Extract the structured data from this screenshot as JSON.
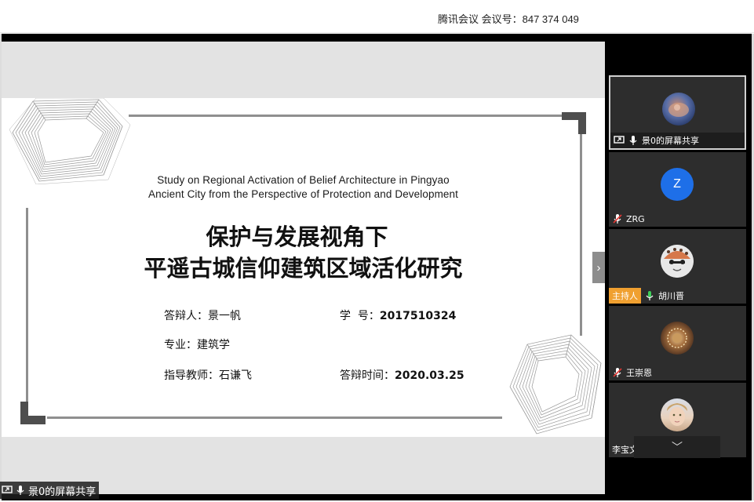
{
  "window": {
    "title": "腾讯会议 会议号：847 374 049"
  },
  "slide": {
    "title_en_line1": "Study on Regional Activation of Belief Architecture in Pingyao",
    "title_en_line2": "Ancient City from the Perspective of Protection and Development",
    "title_zh_line1": "保护与发展视角下",
    "title_zh_line2": "平遥古城信仰建筑区域活化研究",
    "defender_label": "答辩人：",
    "defender_value": "景一帆",
    "student_id_label": "学  号：",
    "student_id_value": "2017510324",
    "major_label": "专业：",
    "major_value": "建筑学",
    "advisor_label": "指导教师：",
    "advisor_value": "石谦飞",
    "date_label": "答辩时间：",
    "date_value": "2020.03.25"
  },
  "share": {
    "label": "景0的屏幕共享",
    "next_icon": "chevron-right-icon"
  },
  "participants": [
    {
      "name": "景0的屏幕共享",
      "avatar": "planet-photo-avatar",
      "mic": "mic-on",
      "screen_icon": "screen-share-icon"
    },
    {
      "name": "ZRG",
      "avatar_letter": "Z",
      "avatar_color": "#1e6fe8",
      "mic": "mic-muted"
    },
    {
      "name": "胡川晋",
      "avatar": "cartoon-cat-avatar",
      "mic": "mic-on",
      "badge": "主持人"
    },
    {
      "name": "王崇恩",
      "avatar": "ornament-photo-avatar",
      "mic": "mic-muted"
    },
    {
      "name": "李宝文",
      "avatar": "portrait-photo-avatar",
      "mic": "none"
    }
  ],
  "colors": {
    "host_badge": "#f0a030",
    "tile_bg": "#2d2d2d",
    "avatar_blue": "#1e6fe8"
  }
}
